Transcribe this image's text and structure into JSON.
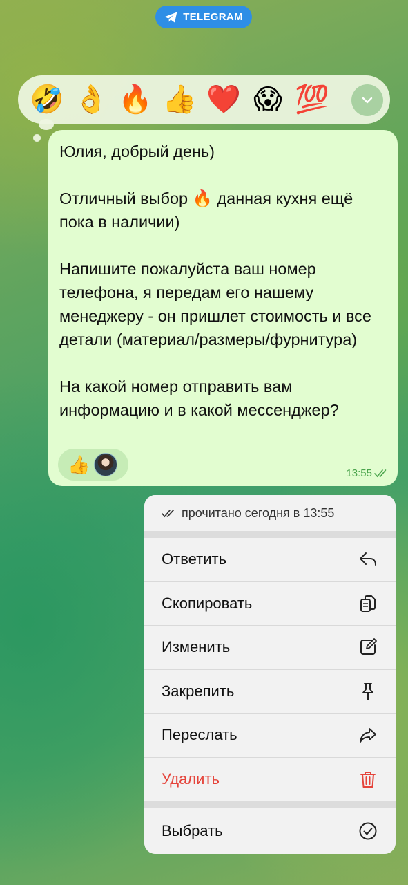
{
  "header": {
    "app_label": "TELEGRAM",
    "icon": "telegram-plane-icon",
    "accent": "#2e8ee6"
  },
  "reactions": [
    {
      "emoji": "🤣",
      "name": "rolling-laughing"
    },
    {
      "emoji": "👌",
      "name": "ok-hand"
    },
    {
      "emoji": "🔥",
      "name": "fire"
    },
    {
      "emoji": "👍",
      "name": "thumbs-up"
    },
    {
      "emoji": "❤️",
      "name": "red-heart"
    },
    {
      "emoji": "😱",
      "name": "screaming-face"
    },
    {
      "emoji": "💯",
      "name": "hundred-points"
    }
  ],
  "message": {
    "text": "Юлия, добрый день)\n\nОтличный выбор 🔥 данная кухня ещё пока в наличии)\n\nНапишите пожалуйста ваш номер телефона, я передам его нашему менеджеру - он пришлет стоимость и все детали (материал/размеры/фурнитура)\n\nНа какой номер отправить вам информацию и в какой мессенджер?",
    "reaction": "👍",
    "time": "13:55",
    "bubble_color": "#e2fdd0"
  },
  "menu": {
    "read_status": "прочитано сегодня в 13:55",
    "items": [
      {
        "label": "Ответить",
        "icon": "reply-icon"
      },
      {
        "label": "Скопировать",
        "icon": "copy-icon"
      },
      {
        "label": "Изменить",
        "icon": "edit-icon"
      },
      {
        "label": "Закрепить",
        "icon": "pin-icon"
      },
      {
        "label": "Переслать",
        "icon": "forward-icon"
      },
      {
        "label": "Удалить",
        "icon": "trash-icon",
        "danger_color": "#e5443b"
      }
    ],
    "select": {
      "label": "Выбрать",
      "icon": "select-check-icon"
    }
  }
}
